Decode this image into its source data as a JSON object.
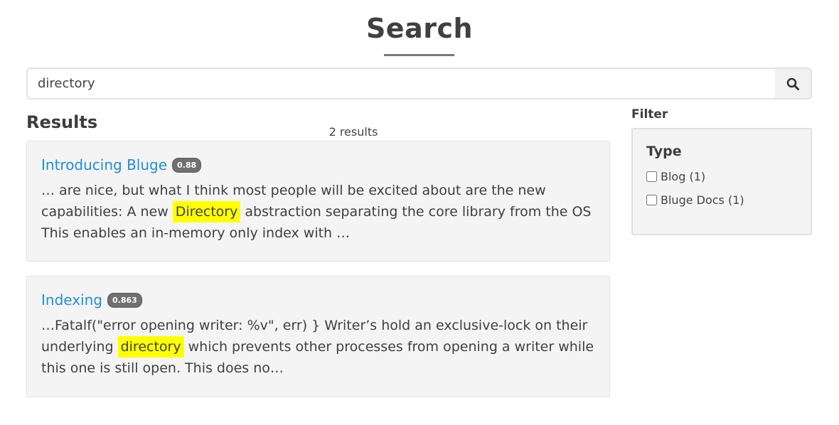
{
  "header": {
    "title": "Search"
  },
  "search": {
    "query": "directory",
    "button_icon": "search-icon"
  },
  "results": {
    "heading": "Results",
    "count_text": "2 results",
    "items": [
      {
        "title": "Introducing Bluge",
        "score": "0.88",
        "snippet_before": "… are nice, but what I think most people will be excited about are the new capabilities: A new ",
        "snippet_highlight": "Directory",
        "snippet_after": " abstraction separating the core library from the OS This enables an in-memory only index with …"
      },
      {
        "title": "Indexing",
        "score": "0.863",
        "snippet_before": "…Fatalf(\"error opening writer: %v\", err) } Writer’s hold an exclusive-lock on their underlying ",
        "snippet_highlight": "directory",
        "snippet_after": " which prevents other processes from opening a writer while this one is still open. This does no…"
      }
    ]
  },
  "filter": {
    "heading": "Filter",
    "group_label": "Type",
    "facets": [
      {
        "label": "Blog (1)",
        "checked": false
      },
      {
        "label": "Bluge Docs (1)",
        "checked": false
      }
    ]
  },
  "colors": {
    "link": "#1e8fd8",
    "highlight": "#ffff00",
    "badge": "#707070"
  }
}
